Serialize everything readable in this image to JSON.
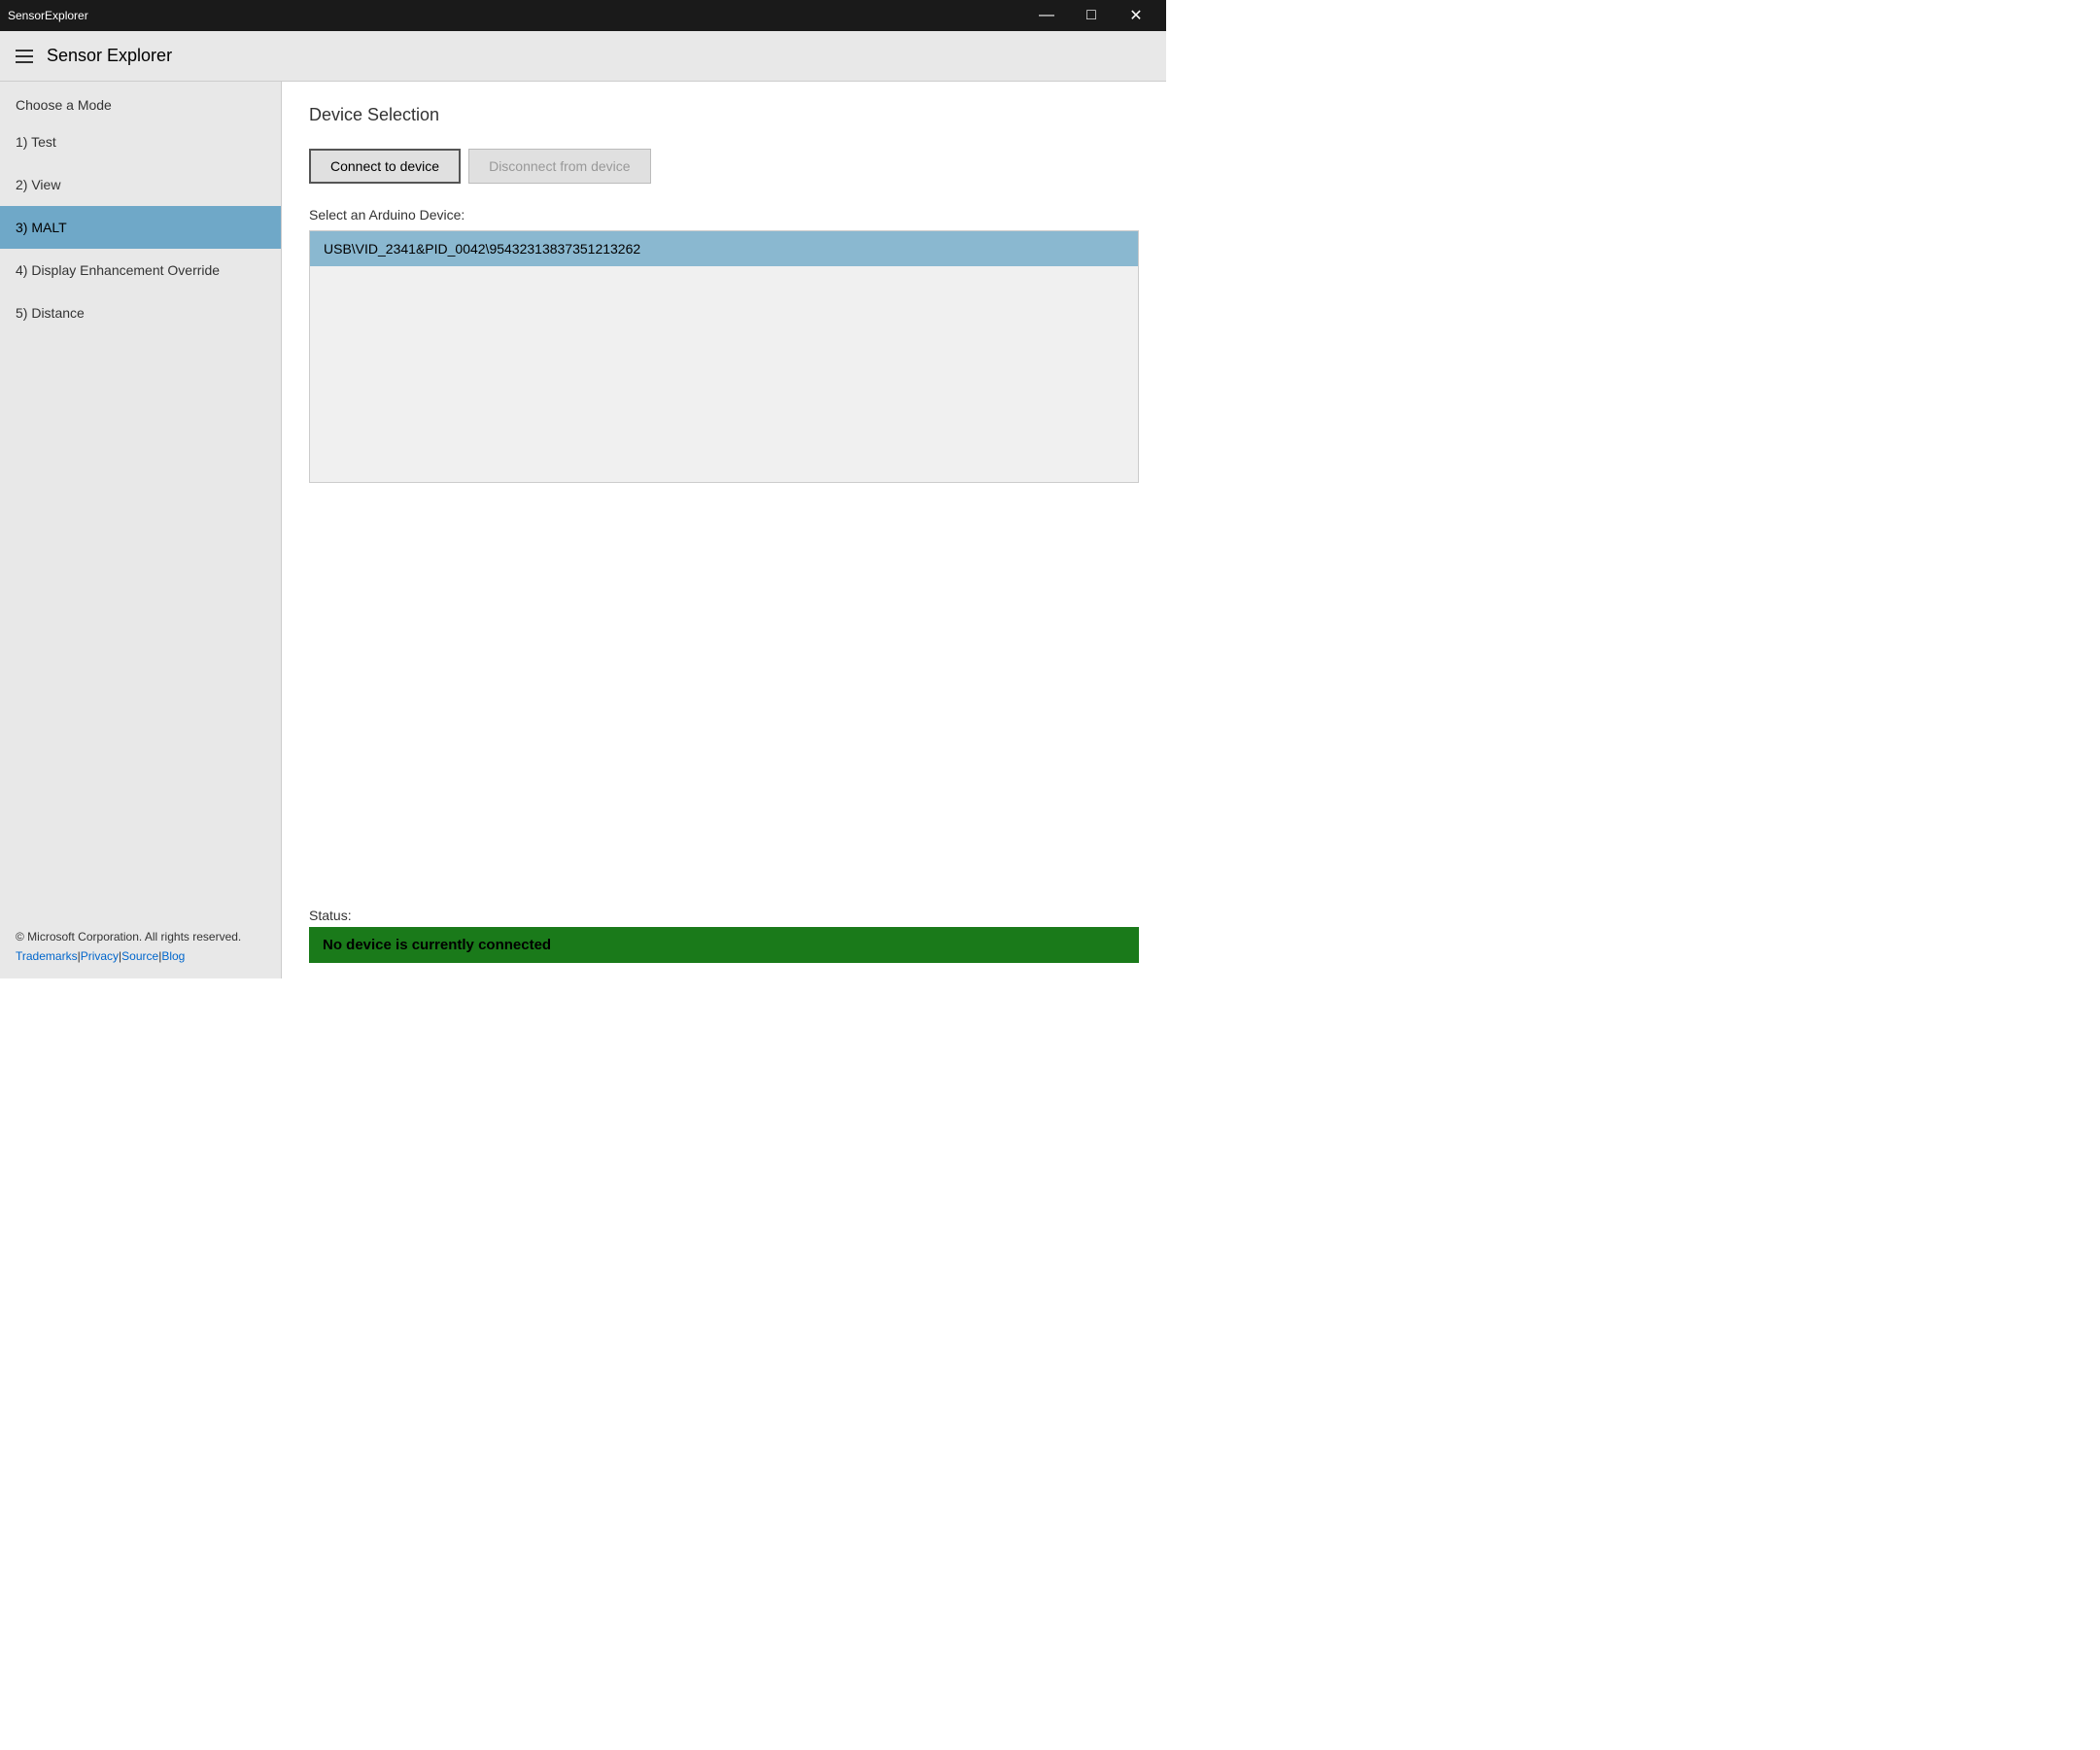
{
  "titlebar": {
    "title": "SensorExplorer",
    "minimize_label": "—",
    "maximize_label": "□",
    "close_label": "✕"
  },
  "app_header": {
    "title": "Sensor Explorer"
  },
  "sidebar": {
    "section_title": "Choose a Mode",
    "items": [
      {
        "id": "test",
        "label": "1) Test",
        "active": false
      },
      {
        "id": "view",
        "label": "2) View",
        "active": false
      },
      {
        "id": "malt",
        "label": "3) MALT",
        "active": true
      },
      {
        "id": "display-enhancement-override",
        "label": "4) Display Enhancement Override",
        "active": false
      },
      {
        "id": "distance",
        "label": "5) Distance",
        "active": false
      }
    ],
    "footer": {
      "copyright": "© Microsoft Corporation. All rights reserved.",
      "links": [
        {
          "id": "trademarks",
          "label": "Trademarks"
        },
        {
          "id": "privacy",
          "label": "Privacy"
        },
        {
          "id": "source",
          "label": "Source"
        },
        {
          "id": "blog",
          "label": "Blog"
        }
      ]
    }
  },
  "content": {
    "section_title": "Device Selection",
    "connect_button": "Connect to device",
    "disconnect_button": "Disconnect from device",
    "select_label": "Select an Arduino Device:",
    "devices": [
      {
        "id": "device-1",
        "label": "USB\\VID_2341&PID_0042\\95432313837351213262",
        "selected": true
      }
    ]
  },
  "status": {
    "label": "Status:",
    "text": "No device is currently connected"
  }
}
